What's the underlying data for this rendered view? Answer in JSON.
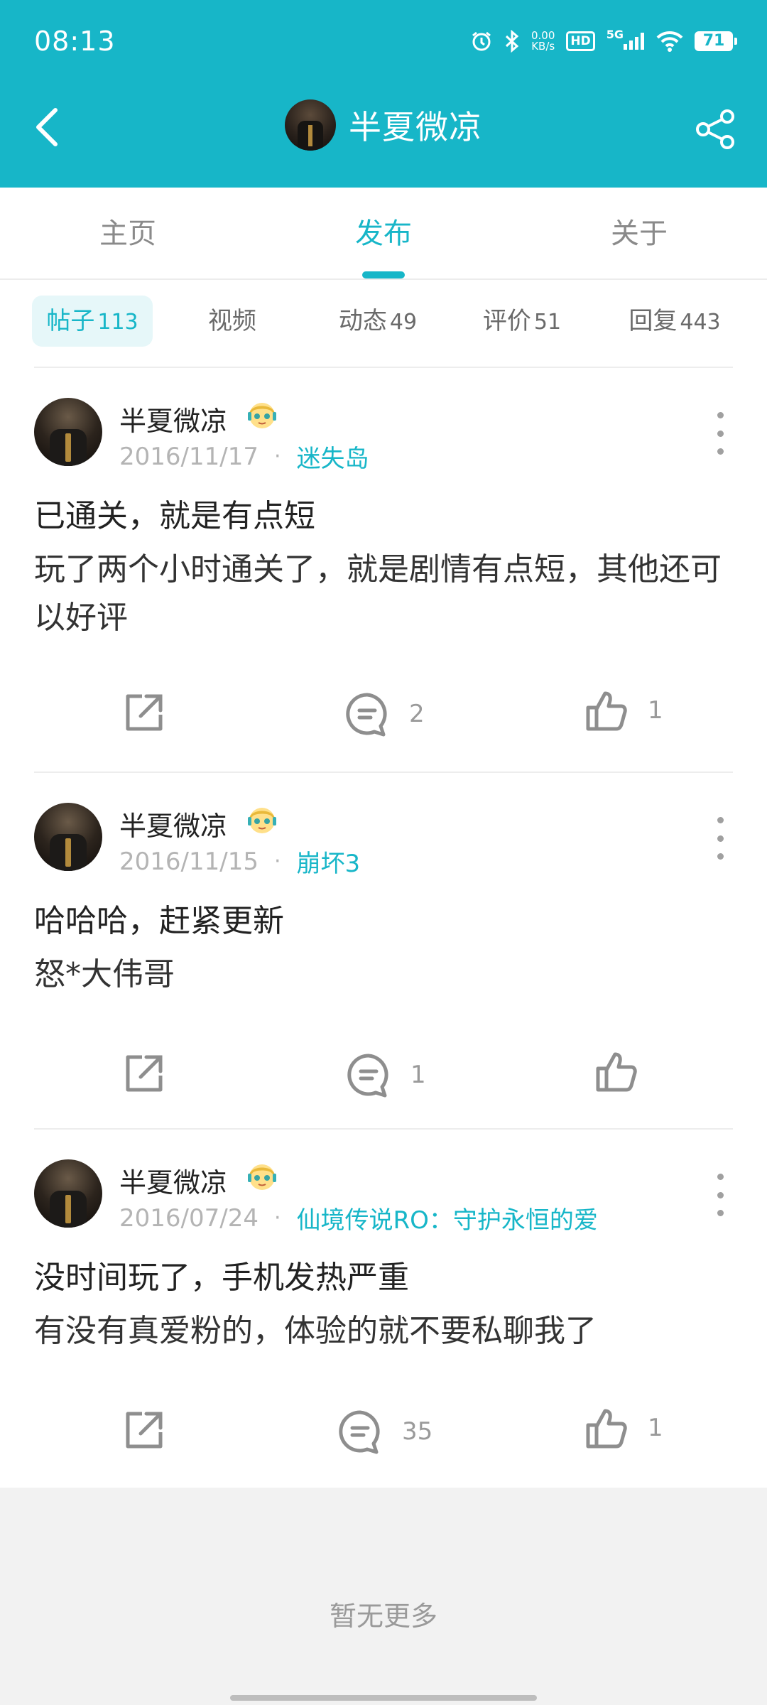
{
  "status_bar": {
    "time": "08:13",
    "net_speed_value": "0.00",
    "net_speed_unit": "KB/s",
    "hd_label": "HD",
    "network_label": "5G",
    "battery": "71",
    "icons": [
      "alarm-icon",
      "bluetooth-icon",
      "signal-icon",
      "wifi-icon",
      "battery-icon"
    ]
  },
  "header": {
    "title": "半夏微凉",
    "background_color": "#17b6c8",
    "icons": [
      "back-arrow-icon",
      "share-icon"
    ]
  },
  "main_tabs": [
    {
      "label": "主页",
      "active": false
    },
    {
      "label": "发布",
      "active": true
    },
    {
      "label": "关于",
      "active": false
    }
  ],
  "sub_tabs": [
    {
      "label": "帖子",
      "count": "113",
      "active": true
    },
    {
      "label": "视频",
      "count": "",
      "active": false
    },
    {
      "label": "动态",
      "count": "49",
      "active": false
    },
    {
      "label": "评价",
      "count": "51",
      "active": false
    },
    {
      "label": "回复",
      "count": "443",
      "active": false
    }
  ],
  "posts": [
    {
      "username": "半夏微凉",
      "date": "2016/11/17",
      "separator": "·",
      "game": "迷失岛",
      "title": "已通关，就是有点短",
      "body": "玩了两个小时通关了，就是剧情有点短，其他还可以好评",
      "comments": "2",
      "likes": "1"
    },
    {
      "username": "半夏微凉",
      "date": "2016/11/15",
      "separator": "·",
      "game": "崩坏3",
      "title": "哈哈哈，赶紧更新",
      "body": "怒*大伟哥",
      "comments": "1",
      "likes": ""
    },
    {
      "username": "半夏微凉",
      "date": "2016/07/24",
      "separator": "·",
      "game": "仙境传说RO：守护永恒的爱",
      "title": "没时间玩了，手机发热严重",
      "body": "有没有真爱粉的，体验的就不要私聊我了",
      "comments": "35",
      "likes": "1"
    }
  ],
  "footer": {
    "text": "暂无更多"
  },
  "colors": {
    "accent": "#17b6c8",
    "text_primary": "#222222",
    "text_secondary": "#b4b4b4",
    "footer_bg": "#f2f2f2"
  }
}
